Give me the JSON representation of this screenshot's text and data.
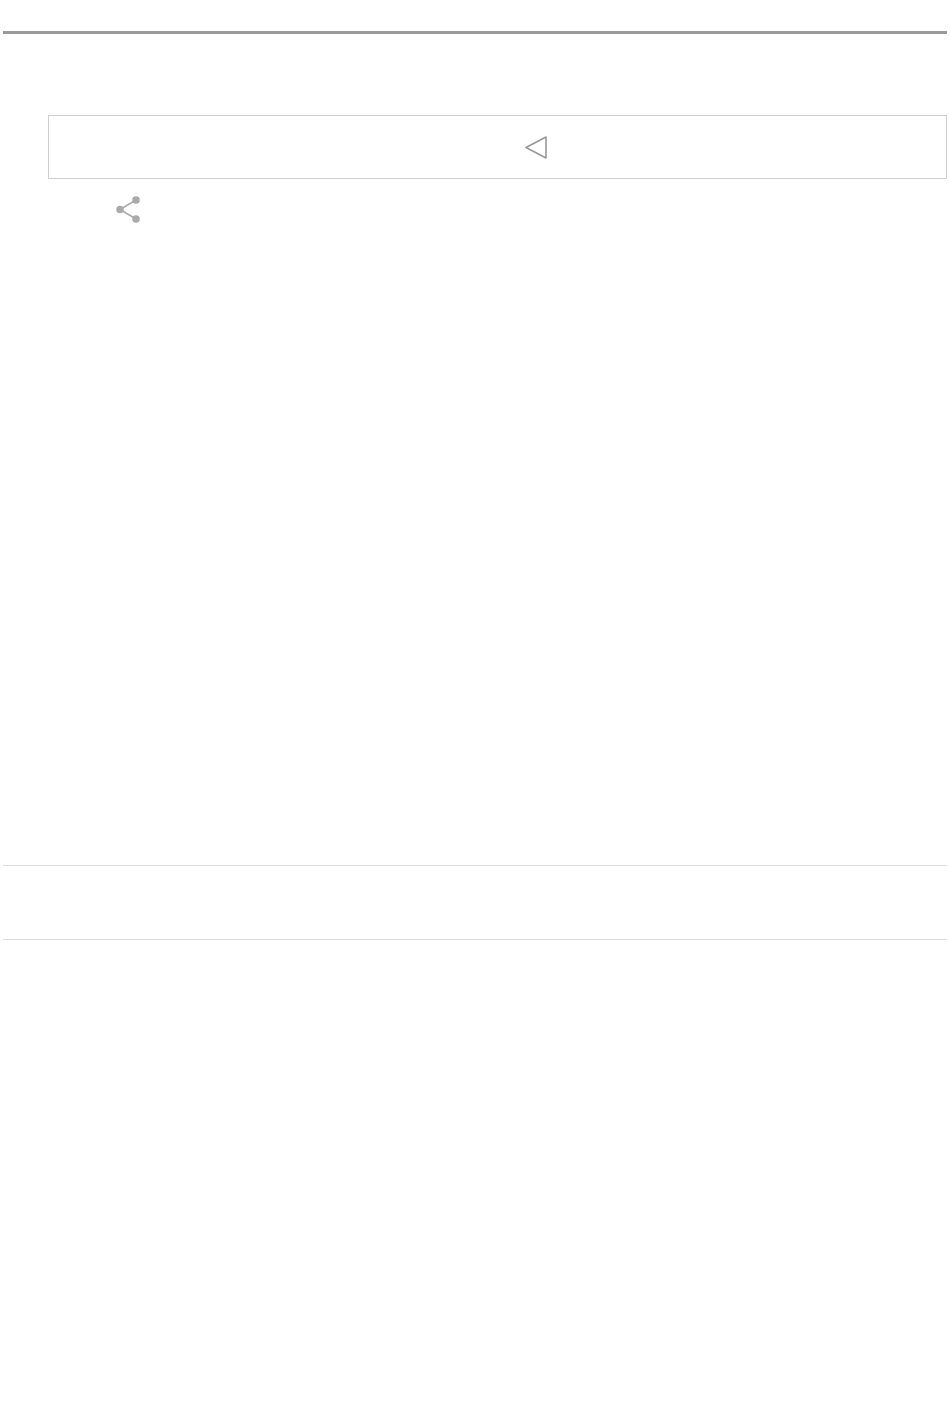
{
  "player": {
    "kind": "audio"
  },
  "share": {
    "kind": "share"
  }
}
